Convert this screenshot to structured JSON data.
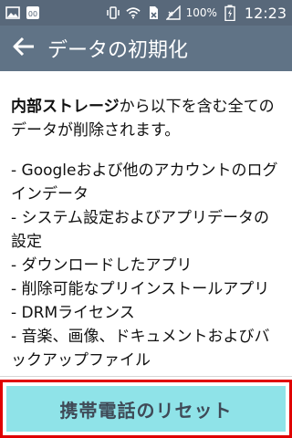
{
  "status_bar": {
    "left_icons": [
      "image-icon",
      "app-icon"
    ],
    "right_icons": [
      "vibrate-icon",
      "wifi-icon",
      "no-sim-icon",
      "signal-icon",
      "battery-charging-icon"
    ],
    "battery_percent": "100%",
    "time": "12:23"
  },
  "app_bar": {
    "title": "データの初期化",
    "back_icon": "back-arrow-icon"
  },
  "content": {
    "intro_bold": "内部ストレージ",
    "intro_rest": "から以下を含む全てのデータが削除されます。",
    "items": [
      "- Googleおよび他のアカウントのログインデータ",
      "- システム設定およびアプリデータの設定",
      "- ダウンロードしたアプリ",
      "- 削除可能なプリインストールアプリ",
      "- DRMライセンス",
      "- 音楽、画像、ドキュメントおよびバックアップファイル"
    ]
  },
  "reset_button": {
    "label": "携帯電話のリセット"
  },
  "colors": {
    "status_bar": "#58687a",
    "app_bar": "#607386",
    "button_bg": "#8fe3e8",
    "button_text": "#3f4a57",
    "highlight_border": "#e00000"
  }
}
